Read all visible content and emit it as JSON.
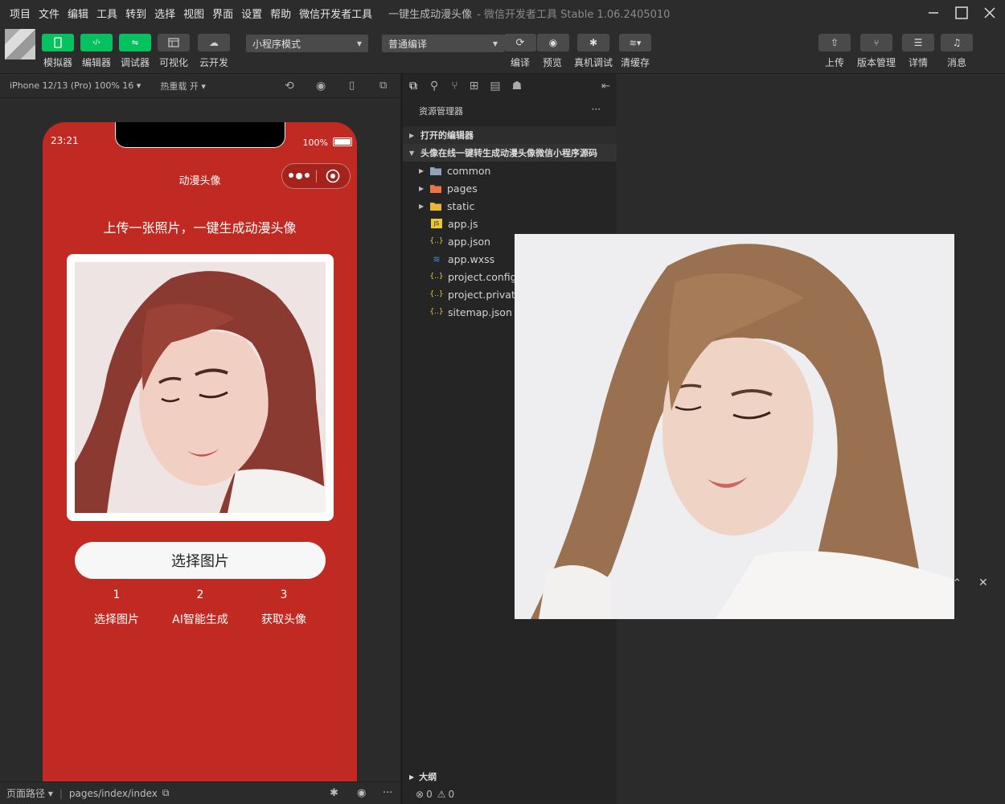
{
  "menu": {
    "items": [
      "项目",
      "文件",
      "编辑",
      "工具",
      "转到",
      "选择",
      "视图",
      "界面",
      "设置",
      "帮助",
      "微信开发者工具"
    ],
    "title": "一键生成动漫头像",
    "subtitle": "- 微信开发者工具 Stable 1.06.2405010"
  },
  "toolbar": {
    "left_buttons": [
      "模拟器",
      "编辑器",
      "调试器",
      "可视化",
      "云开发"
    ],
    "mode_select": "小程序模式",
    "compile_select": "普通编译",
    "mid_buttons": [
      "编译",
      "预览",
      "真机调试",
      "清缓存"
    ],
    "right_buttons": [
      "上传",
      "版本管理",
      "详情",
      "消息"
    ]
  },
  "simulator": {
    "device": "iPhone 12/13 (Pro) 100% 16 ▾",
    "hot_reload": "热重载 开 ▾",
    "status_time": "23:21",
    "battery": "100%",
    "nav_title": "动漫头像",
    "headline": "上传一张照片，一键生成动漫头像",
    "choose_button": "选择图片",
    "steps": [
      {
        "num": "1",
        "text": "选择图片"
      },
      {
        "num": "2",
        "text": "AI智能生成"
      },
      {
        "num": "3",
        "text": "获取头像"
      }
    ],
    "footer_path_label": "页面路径 ▾",
    "footer_path": "pages/index/index"
  },
  "explorer": {
    "title": "资源管理器",
    "more": "···",
    "open_editors": "打开的编辑器",
    "project": "头像在线一键转生成动漫头像微信小程序源码",
    "items": [
      {
        "name": "common",
        "type": "folder"
      },
      {
        "name": "pages",
        "type": "folder-pages"
      },
      {
        "name": "static",
        "type": "folder-static"
      },
      {
        "name": "app.js",
        "type": "js"
      },
      {
        "name": "app.json",
        "type": "json"
      },
      {
        "name": "app.wxss",
        "type": "css"
      },
      {
        "name": "project.config.j",
        "type": "json"
      },
      {
        "name": "project.private",
        "type": "json"
      },
      {
        "name": "sitemap.json",
        "type": "json"
      }
    ],
    "outline": "大纲",
    "errors": "0",
    "warnings": "0"
  }
}
